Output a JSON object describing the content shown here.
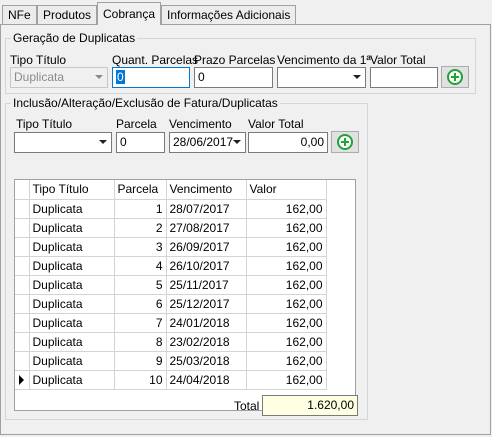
{
  "tabs": [
    {
      "label": "NFe"
    },
    {
      "label": "Produtos"
    },
    {
      "label": "Cobrança",
      "active": true
    },
    {
      "label": "Informações Adicionais"
    }
  ],
  "geracao": {
    "title": "Geração de Duplicatas",
    "tipo_titulo_label": "Tipo Título",
    "tipo_titulo_value": "Duplicata",
    "quant_parcelas_label": "Quant. Parcelas",
    "quant_parcelas_value": "0",
    "prazo_parcelas_label": "Prazo Parcelas",
    "prazo_parcelas_value": "0",
    "vencimento_label": "Vencimento da 1ª",
    "vencimento_value": "",
    "valor_total_label": "Valor Total",
    "valor_total_value": "",
    "add_icon": "add-circle-icon"
  },
  "inclusao": {
    "title": "Inclusão/Alteração/Exclusão de Fatura/Duplicatas",
    "tipo_titulo_label": "Tipo Título",
    "tipo_titulo_value": "",
    "parcela_label": "Parcela",
    "parcela_value": "0",
    "vencimento_label": "Vencimento",
    "vencimento_value": "28/06/2017",
    "valor_total_label": "Valor Total",
    "valor_total_value": "0,00",
    "add_icon": "add-circle-icon"
  },
  "grid": {
    "columns": [
      "Tipo Título",
      "Parcela",
      "Vencimento",
      "Valor"
    ],
    "rows": [
      {
        "tipo": "Duplicata",
        "parcela": "1",
        "vencimento": "28/07/2017",
        "valor": "162,00"
      },
      {
        "tipo": "Duplicata",
        "parcela": "2",
        "vencimento": "27/08/2017",
        "valor": "162,00"
      },
      {
        "tipo": "Duplicata",
        "parcela": "3",
        "vencimento": "26/09/2017",
        "valor": "162,00"
      },
      {
        "tipo": "Duplicata",
        "parcela": "4",
        "vencimento": "26/10/2017",
        "valor": "162,00"
      },
      {
        "tipo": "Duplicata",
        "parcela": "5",
        "vencimento": "25/11/2017",
        "valor": "162,00"
      },
      {
        "tipo": "Duplicata",
        "parcela": "6",
        "vencimento": "25/12/2017",
        "valor": "162,00"
      },
      {
        "tipo": "Duplicata",
        "parcela": "7",
        "vencimento": "24/01/2018",
        "valor": "162,00"
      },
      {
        "tipo": "Duplicata",
        "parcela": "8",
        "vencimento": "23/02/2018",
        "valor": "162,00"
      },
      {
        "tipo": "Duplicata",
        "parcela": "9",
        "vencimento": "25/03/2018",
        "valor": "162,00"
      },
      {
        "tipo": "Duplicata",
        "parcela": "10",
        "vencimento": "24/04/2018",
        "valor": "162,00",
        "current": true
      }
    ]
  },
  "total": {
    "label": "Total",
    "value": "1.620,00"
  }
}
